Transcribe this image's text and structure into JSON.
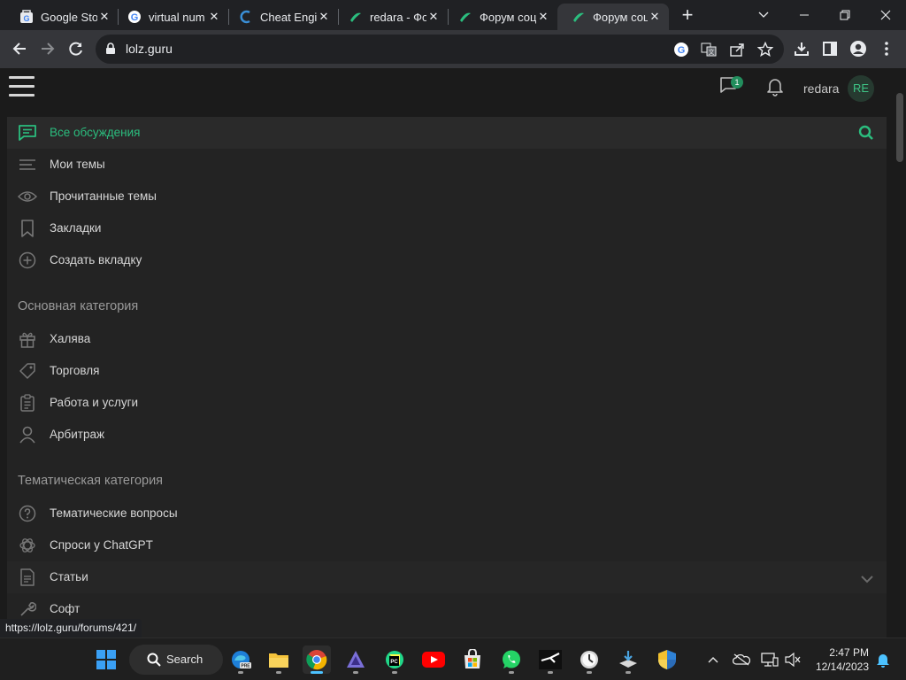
{
  "browser": {
    "tabs": [
      {
        "title": "Google Sto",
        "icon": "google-store-icon"
      },
      {
        "title": "virtual num",
        "icon": "google-icon"
      },
      {
        "title": "Cheat Engi",
        "icon": "cheat-engine-icon"
      },
      {
        "title": "redara - Фо",
        "icon": "lolz-icon"
      },
      {
        "title": "Форум соц",
        "icon": "lolz-icon"
      },
      {
        "title": "Форум соц",
        "icon": "lolz-icon",
        "active": true
      }
    ],
    "url": "lolz.guru",
    "status_url": "https://lolz.guru/forums/421/"
  },
  "site": {
    "header": {
      "notification_badge": "1",
      "username": "redara",
      "avatar_initials": "RE"
    },
    "nav_main": [
      {
        "label": "Все обсуждения",
        "icon": "chat-icon",
        "active": true
      },
      {
        "label": "Мои темы",
        "icon": "lines-icon"
      },
      {
        "label": "Прочитанные темы",
        "icon": "eye-icon"
      },
      {
        "label": "Закладки",
        "icon": "bookmark-icon"
      },
      {
        "label": "Создать вкладку",
        "icon": "plus-circle-icon"
      }
    ],
    "category_main": {
      "title": "Основная категория",
      "items": [
        {
          "label": "Халява",
          "icon": "gift-icon"
        },
        {
          "label": "Торговля",
          "icon": "tag-icon"
        },
        {
          "label": "Работа и услуги",
          "icon": "clipboard-icon"
        },
        {
          "label": "Арбитраж",
          "icon": "person-icon"
        }
      ]
    },
    "category_thematic": {
      "title": "Тематическая категория",
      "items": [
        {
          "label": "Тематические вопросы",
          "icon": "question-icon"
        },
        {
          "label": "Спроси у ChatGPT",
          "icon": "chatgpt-icon"
        },
        {
          "label": "Статьи",
          "icon": "article-icon",
          "hover": true
        },
        {
          "label": "Софт",
          "icon": "wrench-icon"
        }
      ]
    },
    "colors": {
      "accent": "#2bbd7e",
      "background": "#1b1b1b",
      "panel": "#232323"
    }
  },
  "taskbar": {
    "search_label": "Search",
    "time": "2:47 PM",
    "date": "12/14/2023"
  }
}
